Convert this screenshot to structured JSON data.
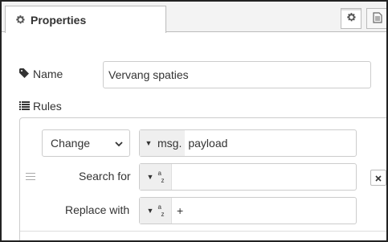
{
  "header": {
    "tab_title": "Properties",
    "tab_icon": "gear-icon",
    "buttons": [
      {
        "icon": "gear-icon",
        "active": true
      },
      {
        "icon": "document-icon",
        "active": false
      }
    ]
  },
  "name": {
    "label": "Name",
    "icon": "tag-icon",
    "value": "Vervang spaties"
  },
  "rules": {
    "label": "Rules",
    "icon": "list-icon",
    "items": [
      {
        "action": "Change",
        "target_type": "msg.",
        "target_value": "payload",
        "search_label": "Search for",
        "search_value": "",
        "replace_label": "Replace with",
        "replace_value": "+"
      }
    ]
  },
  "colors": {
    "border": "#cccccc",
    "type_button_bg": "#efefef",
    "tab_bar_bg": "#f3f3f3"
  }
}
